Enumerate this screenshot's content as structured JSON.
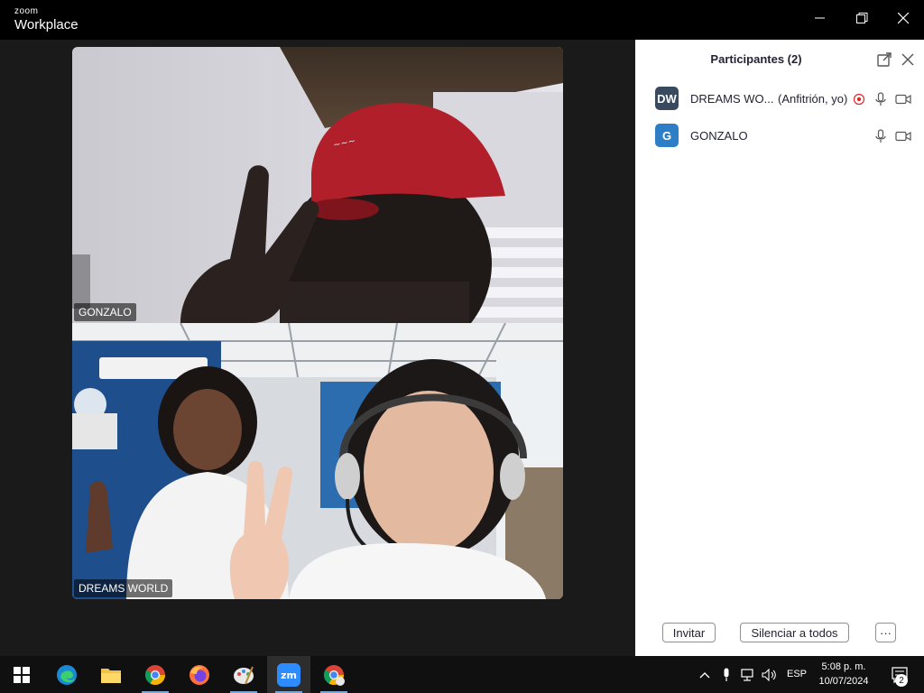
{
  "window": {
    "brand_top": "zoom",
    "brand_main": "Workplace"
  },
  "video_tiles": [
    {
      "name": "GONZALO"
    },
    {
      "name": "DREAMS WORLD"
    }
  ],
  "participants_panel": {
    "title": "Participantes (2)",
    "participants": [
      {
        "initials": "DW",
        "name": "DREAMS WO...",
        "role": "(Anfitrión, yo)",
        "avatar_color": "#3a4a5e",
        "recording": true
      },
      {
        "initials": "G",
        "name": "GONZALO",
        "role": "",
        "avatar_color": "#2d7ec6",
        "recording": false
      }
    ],
    "invite_label": "Invitar",
    "mute_all_label": "Silenciar a todos",
    "more_label": "···"
  },
  "taskbar": {
    "language": "ESP",
    "time": "5:08 p. m.",
    "date": "10/07/2024",
    "notifications_count": "2",
    "apps": [
      "start-icon",
      "edge-icon",
      "file-explorer-icon",
      "chrome-icon",
      "firefox-icon",
      "paint-icon",
      "zoom-icon",
      "chrome-profile-icon"
    ]
  },
  "colors": {
    "panel_bg": "#ffffff",
    "video_bg": "#1a1a1a",
    "recording_dot": "#e02828",
    "taskbar_bg": "#101010"
  }
}
